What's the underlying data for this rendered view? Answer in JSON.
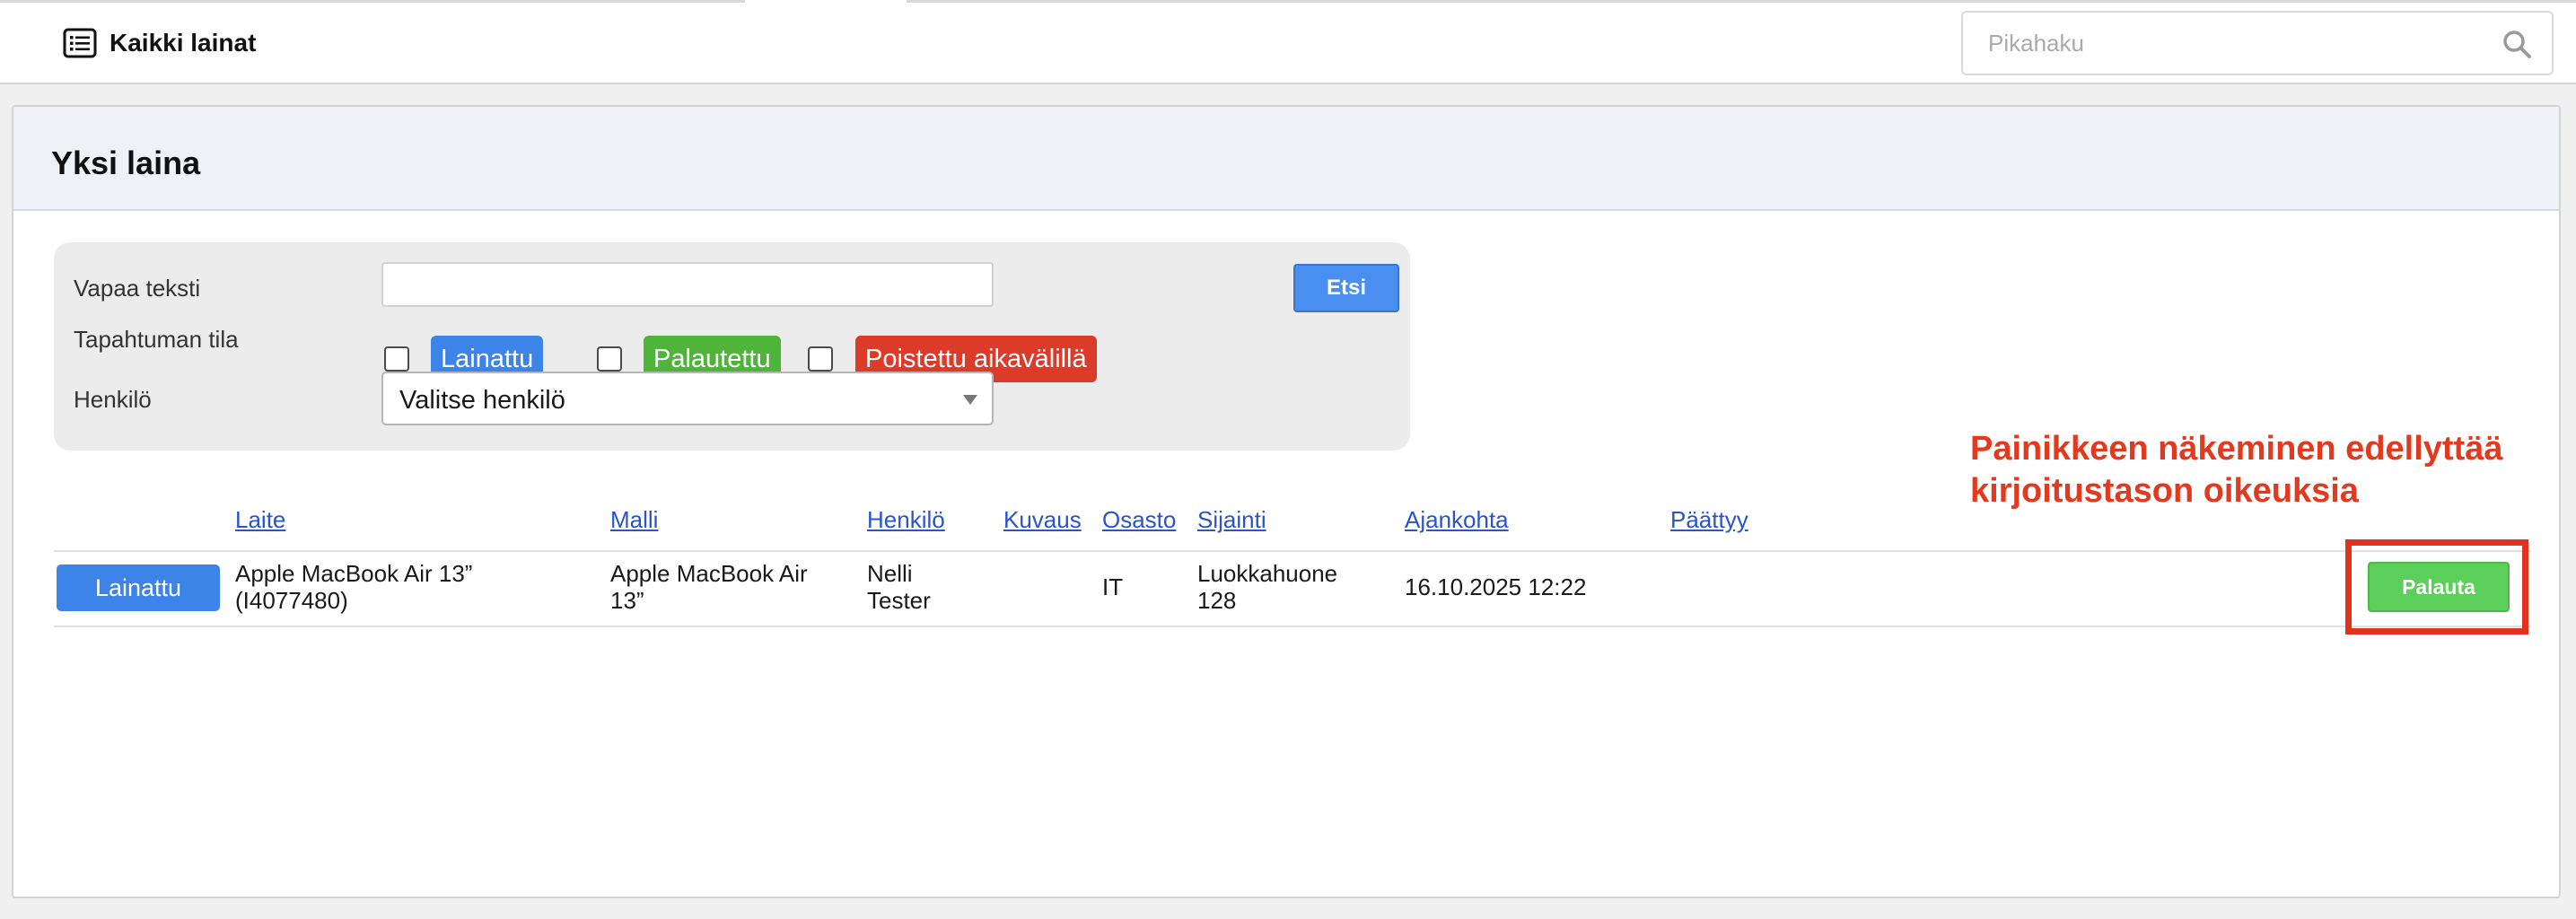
{
  "header": {
    "title": "Kaikki lainat",
    "title_icon": "list-icon",
    "quicksearch": {
      "placeholder": "Pikahaku",
      "icon": "search-icon"
    }
  },
  "panel": {
    "title": "Yksi laina"
  },
  "filters": {
    "free_text_label": "Vapaa teksti",
    "free_text_value": "",
    "search_button": "Etsi",
    "status_label": "Tapahtuman tila",
    "statuses": [
      {
        "label": "Lainattu",
        "checked": false,
        "color": "#3d84e8"
      },
      {
        "label": "Palautettu",
        "checked": false,
        "color": "#4fb53a"
      },
      {
        "label": "Poistettu aikavälillä",
        "checked": false,
        "color": "#db3b28"
      }
    ],
    "person_label": "Henkilö",
    "person_selected": "Valitse henkilö"
  },
  "table": {
    "columns": [
      "Laite",
      "Malli",
      "Henkilö",
      "Kuvaus",
      "Osasto",
      "Sijainti",
      "Ajankohta",
      "Päättyy"
    ],
    "rows": [
      {
        "status": "Lainattu",
        "device_line1": "Apple MacBook Air 13”",
        "device_line2": "(I4077480)",
        "model_line1": "Apple MacBook Air",
        "model_line2": "13”",
        "person_line1": "Nelli",
        "person_line2": "Tester",
        "description": "",
        "department": "IT",
        "location_line1": "Luokkahuone",
        "location_line2": "128",
        "time": "16.10.2025 12:22",
        "ends": "",
        "action": "Palauta"
      }
    ]
  },
  "annotation": {
    "line1": "Painikkeen näkeminen edellyttää",
    "line2": "kirjoitustason oikeuksia",
    "color": "#e2391f"
  }
}
